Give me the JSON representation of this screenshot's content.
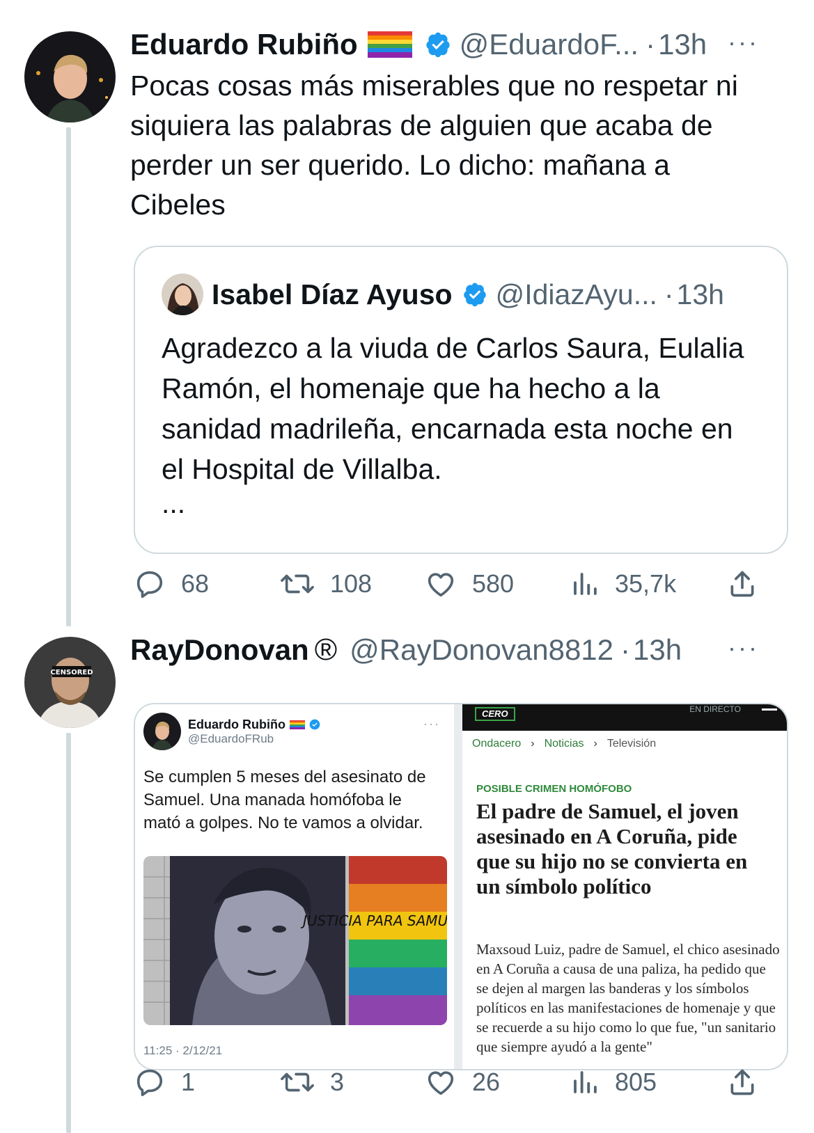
{
  "tweets": [
    {
      "name": "Eduardo Rubiño",
      "flag": "🏳️‍🌈",
      "handle": "@EduardoF...",
      "dot": "·",
      "time": "13h",
      "more": "···",
      "text": "Pocas cosas más miserables que no respetar ni siquiera las palabras de alguien que acaba de perder un ser querido. Lo dicho: mañana a Cibeles",
      "quote": {
        "name": "Isabel Díaz Ayuso",
        "handle": "@IdiazAyu...",
        "dot": "·",
        "time": "13h",
        "text": "Agradezco a la viuda de Carlos Saura, Eulalia Ramón, el homenaje que ha hecho a la sanidad madrileña, encarnada esta noche en el Hospital de Villalba.",
        "ellipsis": "..."
      },
      "stats": {
        "replies": "68",
        "retweets": "108",
        "likes": "580",
        "views": "35,7k"
      }
    },
    {
      "name": "RayDonovan",
      "mark": "®",
      "handle": "@RayDonovan8812",
      "dot": "·",
      "time": "13h",
      "more": "···",
      "media": {
        "left": {
          "name": "Eduardo Rubiño",
          "flag": "🏳️‍🌈",
          "handle": "@EduardoFRub",
          "more": "···",
          "text": "Se cumplen 5 meses del asesinato de Samuel. Una manada homófoba le mató a golpes. No te vamos a olvidar.",
          "mural_text": "JUSTICIA PARA SAMUEL",
          "timestamp": "11:25 · 2/12/21"
        },
        "right": {
          "logo": "CERO",
          "live": "EN DIRECTO",
          "breadcrumb": [
            "Ondacero",
            "Noticias",
            "Televisión"
          ],
          "breadcrumb_sep": "›",
          "kicker": "POSIBLE CRIMEN HOMÓFOBO",
          "headline": "El padre de Samuel, el joven asesinado en A Coruña, pide que su hijo no se convierta en un símbolo político",
          "body": "Maxsoud Luiz, padre de Samuel, el chico asesinado en A Coruña a causa de una paliza, ha pedido que se dejen al margen las banderas y los símbolos políticos en las manifestaciones de homenaje y que se recuerde a su hijo como lo que fue, \"un sanitario que siempre ayudó a la gente\""
        }
      },
      "stats": {
        "replies": "1",
        "retweets": "3",
        "likes": "26",
        "views": "805"
      }
    }
  ],
  "colors": {
    "verified": "#1d9bf0",
    "secondary": "#536471",
    "border": "#cfd9de"
  },
  "icons": [
    "reply-icon",
    "retweet-icon",
    "like-icon",
    "views-icon",
    "share-icon",
    "verified-icon",
    "more-icon"
  ]
}
